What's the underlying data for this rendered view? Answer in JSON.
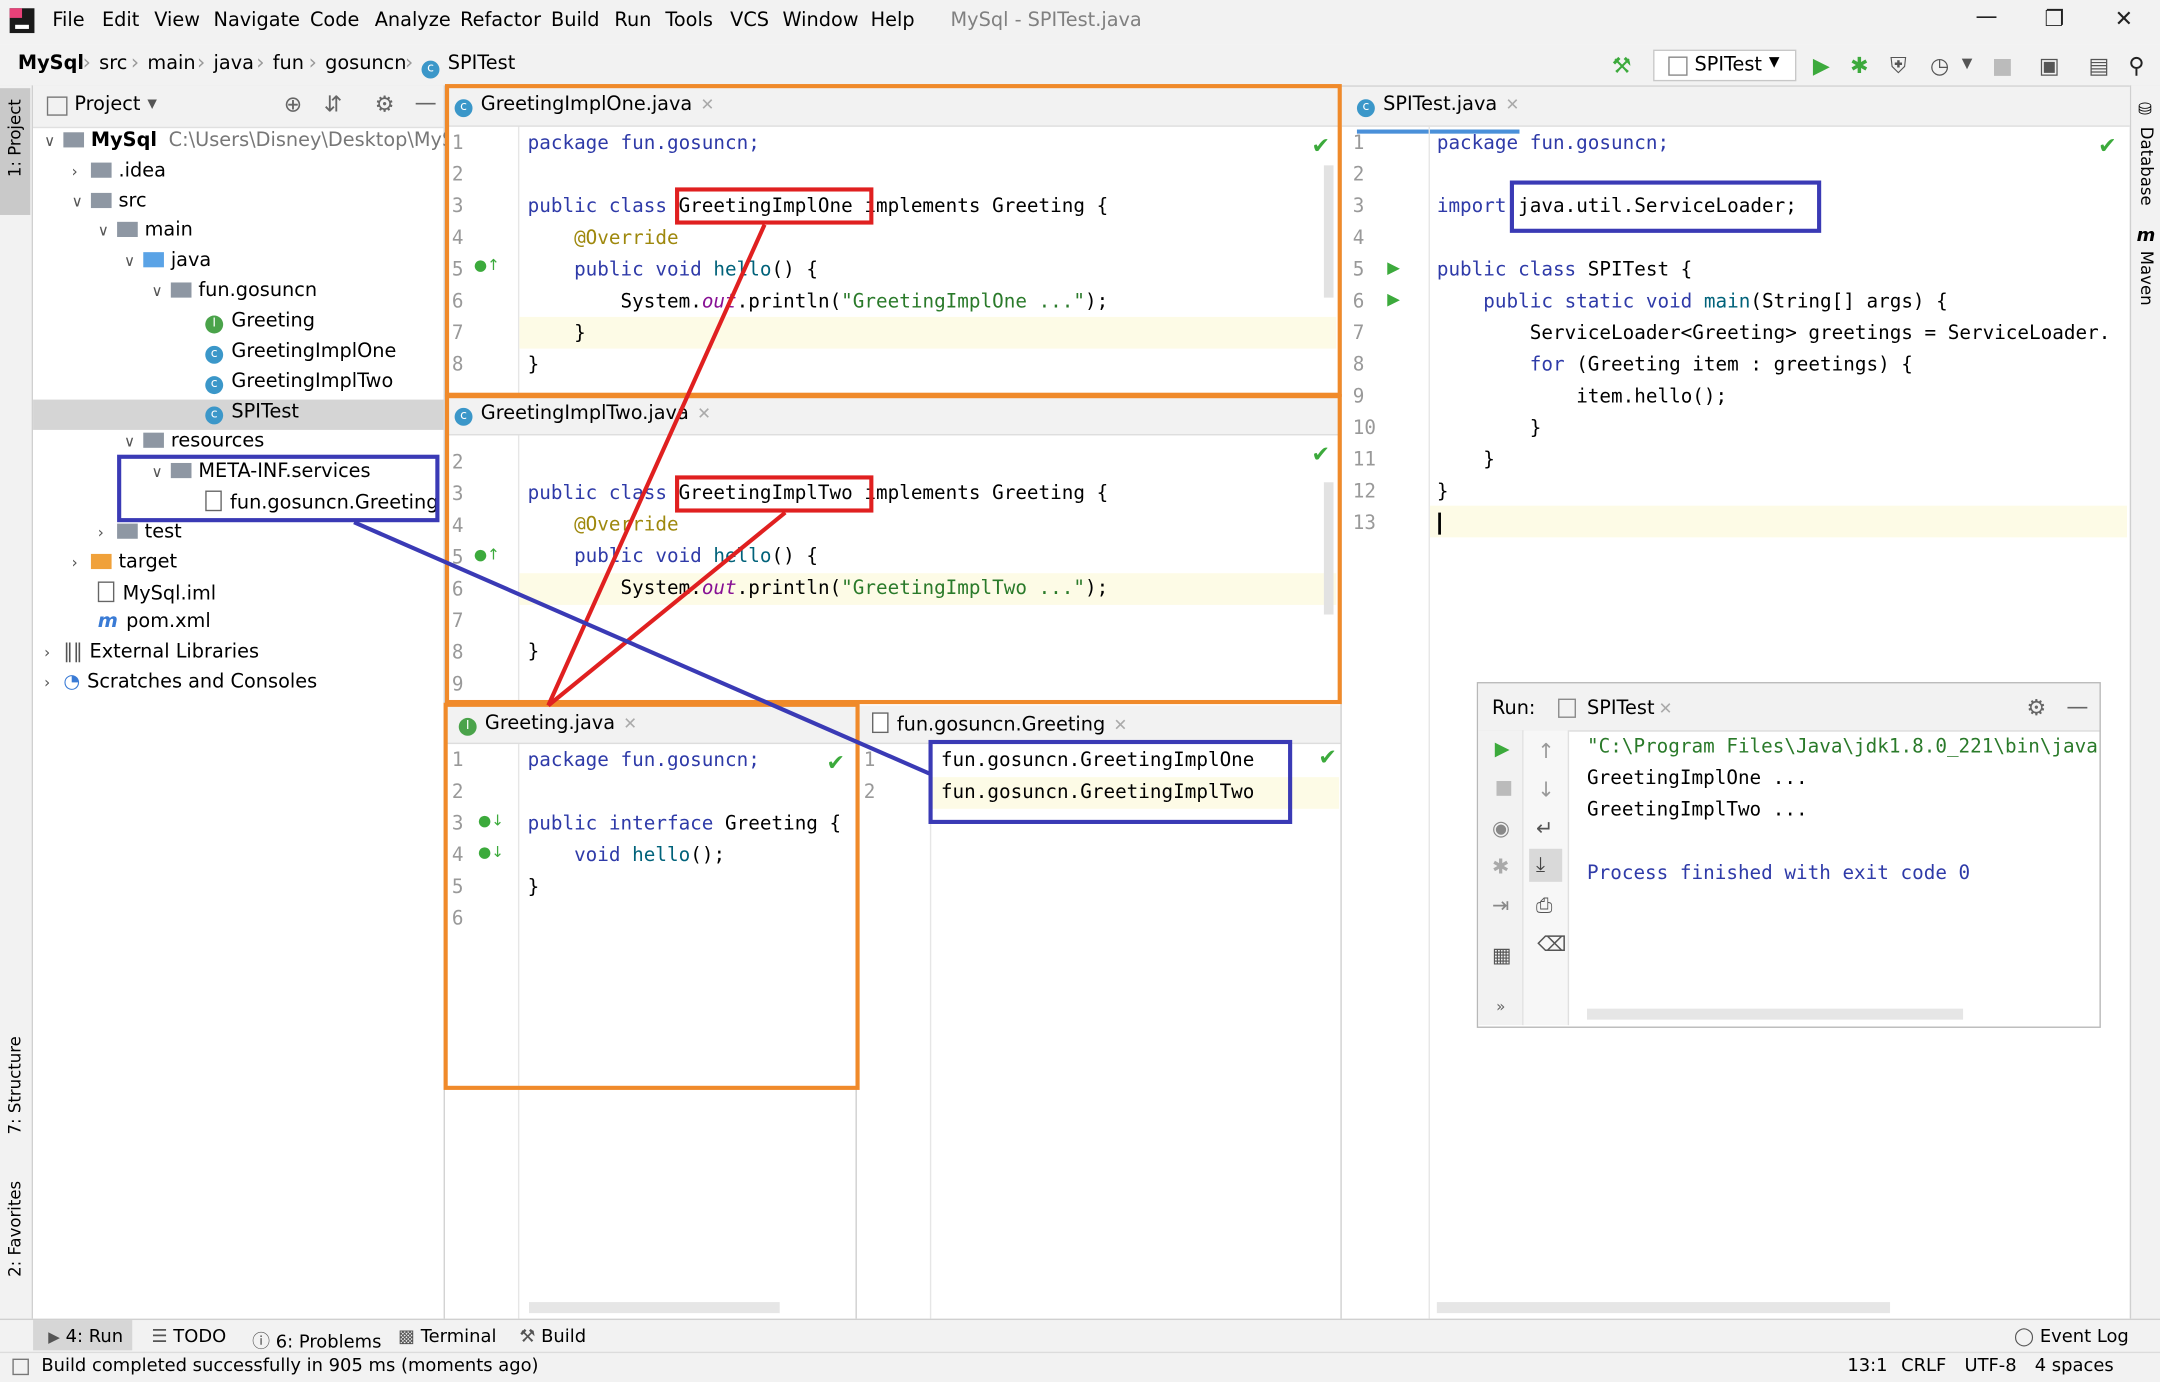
{
  "menubar": {
    "items": [
      "File",
      "Edit",
      "View",
      "Navigate",
      "Code",
      "Analyze",
      "Refactor",
      "Build",
      "Run",
      "Tools",
      "VCS",
      "Window",
      "Help"
    ],
    "window_title": "MySql - SPITest.java"
  },
  "navbar": {
    "breadcrumbs": [
      "MySql",
      "src",
      "main",
      "java",
      "fun",
      "gosuncn",
      "SPITest"
    ],
    "run_config": "SPITest"
  },
  "left_strip": {
    "project_tab": "1: Project",
    "structure_tab": "7: Structure",
    "favorites_tab": "2: Favorites"
  },
  "right_strip": {
    "database_tab": "Database",
    "maven_tab": "Maven"
  },
  "project": {
    "header_label": "Project",
    "root_name": "MySql",
    "root_path": "C:\\Users\\Disney\\Desktop\\MySql",
    "items": [
      ".idea",
      "src",
      "main",
      "java",
      "fun.gosuncn",
      "Greeting",
      "GreetingImplOne",
      "GreetingImplTwo",
      "SPITest",
      "resources",
      "META-INF.services",
      "fun.gosuncn.Greeting",
      "test",
      "target",
      "MySql.iml",
      "pom.xml",
      "External Libraries",
      "Scratches and Consoles"
    ]
  },
  "editor_one": {
    "tab": "GreetingImplOne.java",
    "line_numbers": [
      "1",
      "2",
      "3",
      "4",
      "5",
      "6",
      "7",
      "8"
    ],
    "lines": {
      "l1": "package fun.gosuncn;",
      "l3_kw": "public class ",
      "l3_name": "GreetingImplOne",
      "l3_rest": " implements Greeting {",
      "l4": "@Override",
      "l5_kw": "public void ",
      "l5_fn": "hello",
      "l5_rest": "() {",
      "l6_a": "System.",
      "l6_f": "out",
      "l6_b": ".println(",
      "l6_s": "\"GreetingImplOne ...\"",
      "l6_c": ");",
      "l7": "}",
      "l8": "}"
    }
  },
  "editor_two": {
    "tab": "GreetingImplTwo.java",
    "line_numbers": [
      "2",
      "3",
      "4",
      "5",
      "6",
      "7",
      "8",
      "9"
    ],
    "lines": {
      "l3_kw": "public class ",
      "l3_name": "GreetingImplTwo",
      "l3_rest": " implements Greeting {",
      "l4": "@Override",
      "l5_kw": "public void ",
      "l5_fn": "hello",
      "l5_rest": "() {",
      "l6_a": "System.",
      "l6_f": "out",
      "l6_b": ".println(",
      "l6_s": "\"GreetingImplTwo ...\"",
      "l6_c": ");",
      "l8": "}"
    }
  },
  "editor_greeting": {
    "tab": "Greeting.java",
    "line_numbers": [
      "1",
      "2",
      "3",
      "4",
      "5",
      "6"
    ],
    "lines": {
      "l1": "package fun.gosuncn;",
      "l3_kw": "public interface ",
      "l3_rest": "Greeting {",
      "l4_kw": "void ",
      "l4_fn": "hello",
      "l4_rest": "();",
      "l5": "}"
    }
  },
  "editor_services": {
    "tab": "fun.gosuncn.Greeting",
    "line_numbers": [
      "1",
      "2"
    ],
    "lines": [
      "fun.gosuncn.GreetingImplOne",
      "fun.gosuncn.GreetingImplTwo"
    ]
  },
  "editor_spitest": {
    "tab": "SPITest.java",
    "line_numbers": [
      "1",
      "2",
      "3",
      "4",
      "5",
      "6",
      "7",
      "8",
      "9",
      "10",
      "11",
      "12",
      "13"
    ],
    "lines": {
      "l1": "package fun.gosuncn;",
      "l3_kw": "import ",
      "l3_rest": "java.util.ServiceLoader;",
      "l5_kw": "public class ",
      "l5_rest": "SPITest {",
      "l6_kw": "public static void ",
      "l6_fn": "main",
      "l6_rest": "(String[] args) {",
      "l7": "ServiceLoader<Greeting> greetings = ServiceLoader.",
      "l8_kw": "for ",
      "l8_rest": "(Greeting item : greetings) {",
      "l9": "item.hello();",
      "l10": "}",
      "l11": "}",
      "l12": "}"
    }
  },
  "run_panel": {
    "label": "Run:",
    "tab": "SPITest",
    "output": [
      "\"C:\\Program Files\\Java\\jdk1.8.0_221\\bin\\java",
      "GreetingImplOne ...",
      "GreetingImplTwo ...",
      "",
      "Process finished with exit code 0"
    ]
  },
  "bottom_tabs": [
    "4: Run",
    "TODO",
    "6: Problems",
    "Terminal",
    "Build"
  ],
  "event_log": "Event Log",
  "status": {
    "message": "Build completed successfully in 905 ms (moments ago)",
    "position": "13:1",
    "line_sep": "CRLF",
    "encoding": "UTF-8",
    "indent": "4 spaces"
  },
  "colors": {
    "accent_orange": "#f08a2a",
    "annotation_red": "#e02020",
    "annotation_blue": "#3a3ab5",
    "run_green": "#3caa3c"
  }
}
